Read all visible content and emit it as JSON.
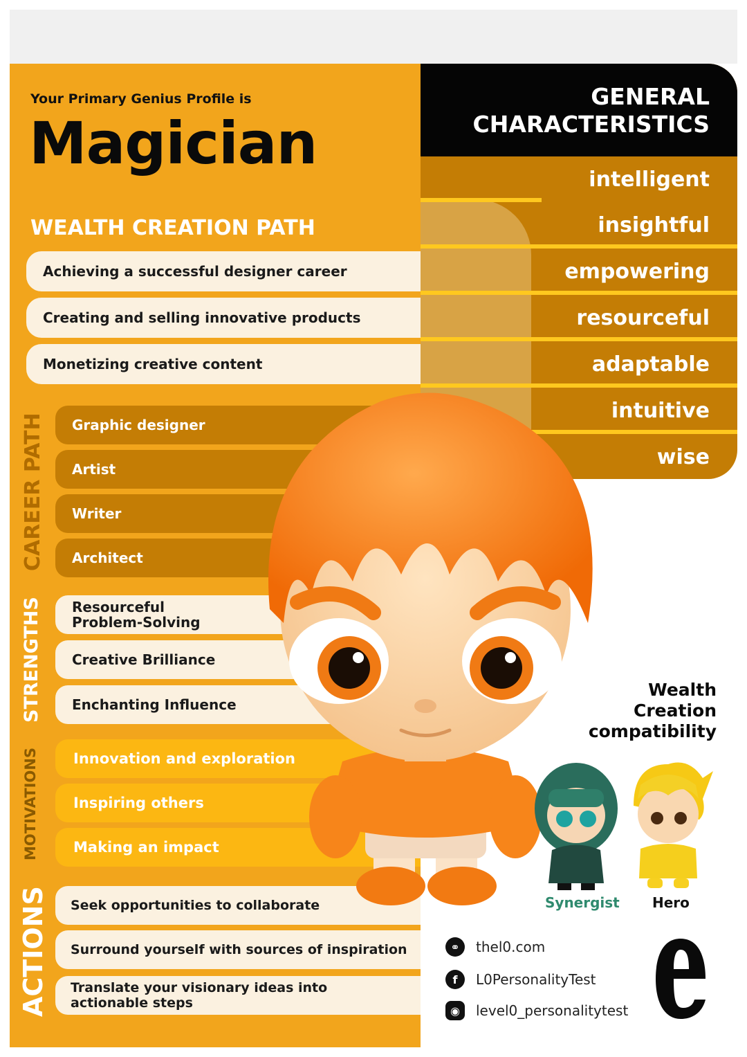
{
  "header": {
    "subtitle": "Your Primary Genius Profile is",
    "title": "Magician"
  },
  "wealth_path": {
    "title": "WEALTH CREATION PATH",
    "items": [
      "Achieving a successful designer career",
      "Creating and selling innovative products",
      "Monetizing creative content"
    ]
  },
  "career_path": {
    "label": "CAREER PATH",
    "items": [
      "Graphic designer",
      "Artist",
      "Writer",
      "Architect"
    ]
  },
  "strengths": {
    "label": "STRENGTHS",
    "items": [
      [
        "Resourceful",
        "Problem-Solving"
      ],
      [
        "Creative Brilliance"
      ],
      [
        "Enchanting Influence"
      ]
    ]
  },
  "motivations": {
    "label": "MOTIVATIONS",
    "items": [
      "Innovation and exploration",
      "Inspiring others",
      "Making an impact"
    ]
  },
  "actions": {
    "label": "ACTIONS",
    "items": [
      [
        "Seek opportunities to collaborate"
      ],
      [
        "Surround yourself with sources of inspiration"
      ],
      [
        "Translate your visionary ideas into",
        "actionable steps"
      ]
    ]
  },
  "characteristics": {
    "title": [
      "GENERAL",
      "CHARACTERISTICS"
    ],
    "traits": [
      "intelligent",
      "insightful",
      "empowering",
      "resourceful",
      "adaptable",
      "intuitive",
      "wise"
    ]
  },
  "compatibility": {
    "title": [
      "Wealth",
      "Creation",
      "compatibility"
    ],
    "profiles": [
      {
        "name": "Synergist",
        "color": "#2f8a6e"
      },
      {
        "name": "Hero",
        "color": "#111111"
      }
    ]
  },
  "social": {
    "website": "thel0.com",
    "facebook": "L0PersonalityTest",
    "instagram": "level0_personalitytest"
  },
  "colors": {
    "primary_orange": "#f2a51c",
    "dark_orange": "#c47d05",
    "gold": "#fcb712",
    "cream": "#fbf1e0",
    "black": "#050505"
  },
  "icons": [
    "globe-icon",
    "facebook-icon",
    "instagram-icon",
    "brand-logo"
  ]
}
